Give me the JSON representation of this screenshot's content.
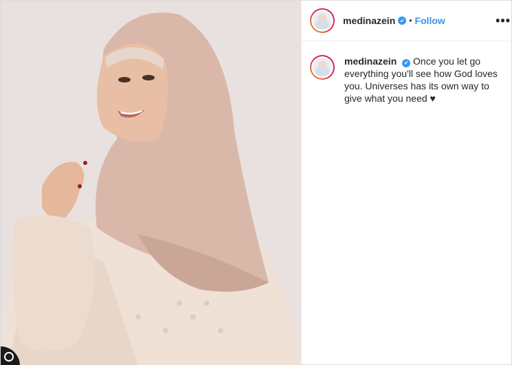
{
  "post": {
    "username": "medinazein",
    "verified_mark": "✔",
    "separator": "•",
    "follow_label": "Follow",
    "more_label": "•••",
    "caption": "Once you let go everything you'll see how God loves you. Universes has its own way to give what you need ♥"
  },
  "colors": {
    "follow": "#3897f0",
    "verified": "#3897f0",
    "hijab": "#d9b8a8",
    "background": "#e8e0de"
  },
  "icons": {
    "more": "three-dots-icon",
    "verified": "verified-badge-icon",
    "corner": "user-tag-icon"
  }
}
